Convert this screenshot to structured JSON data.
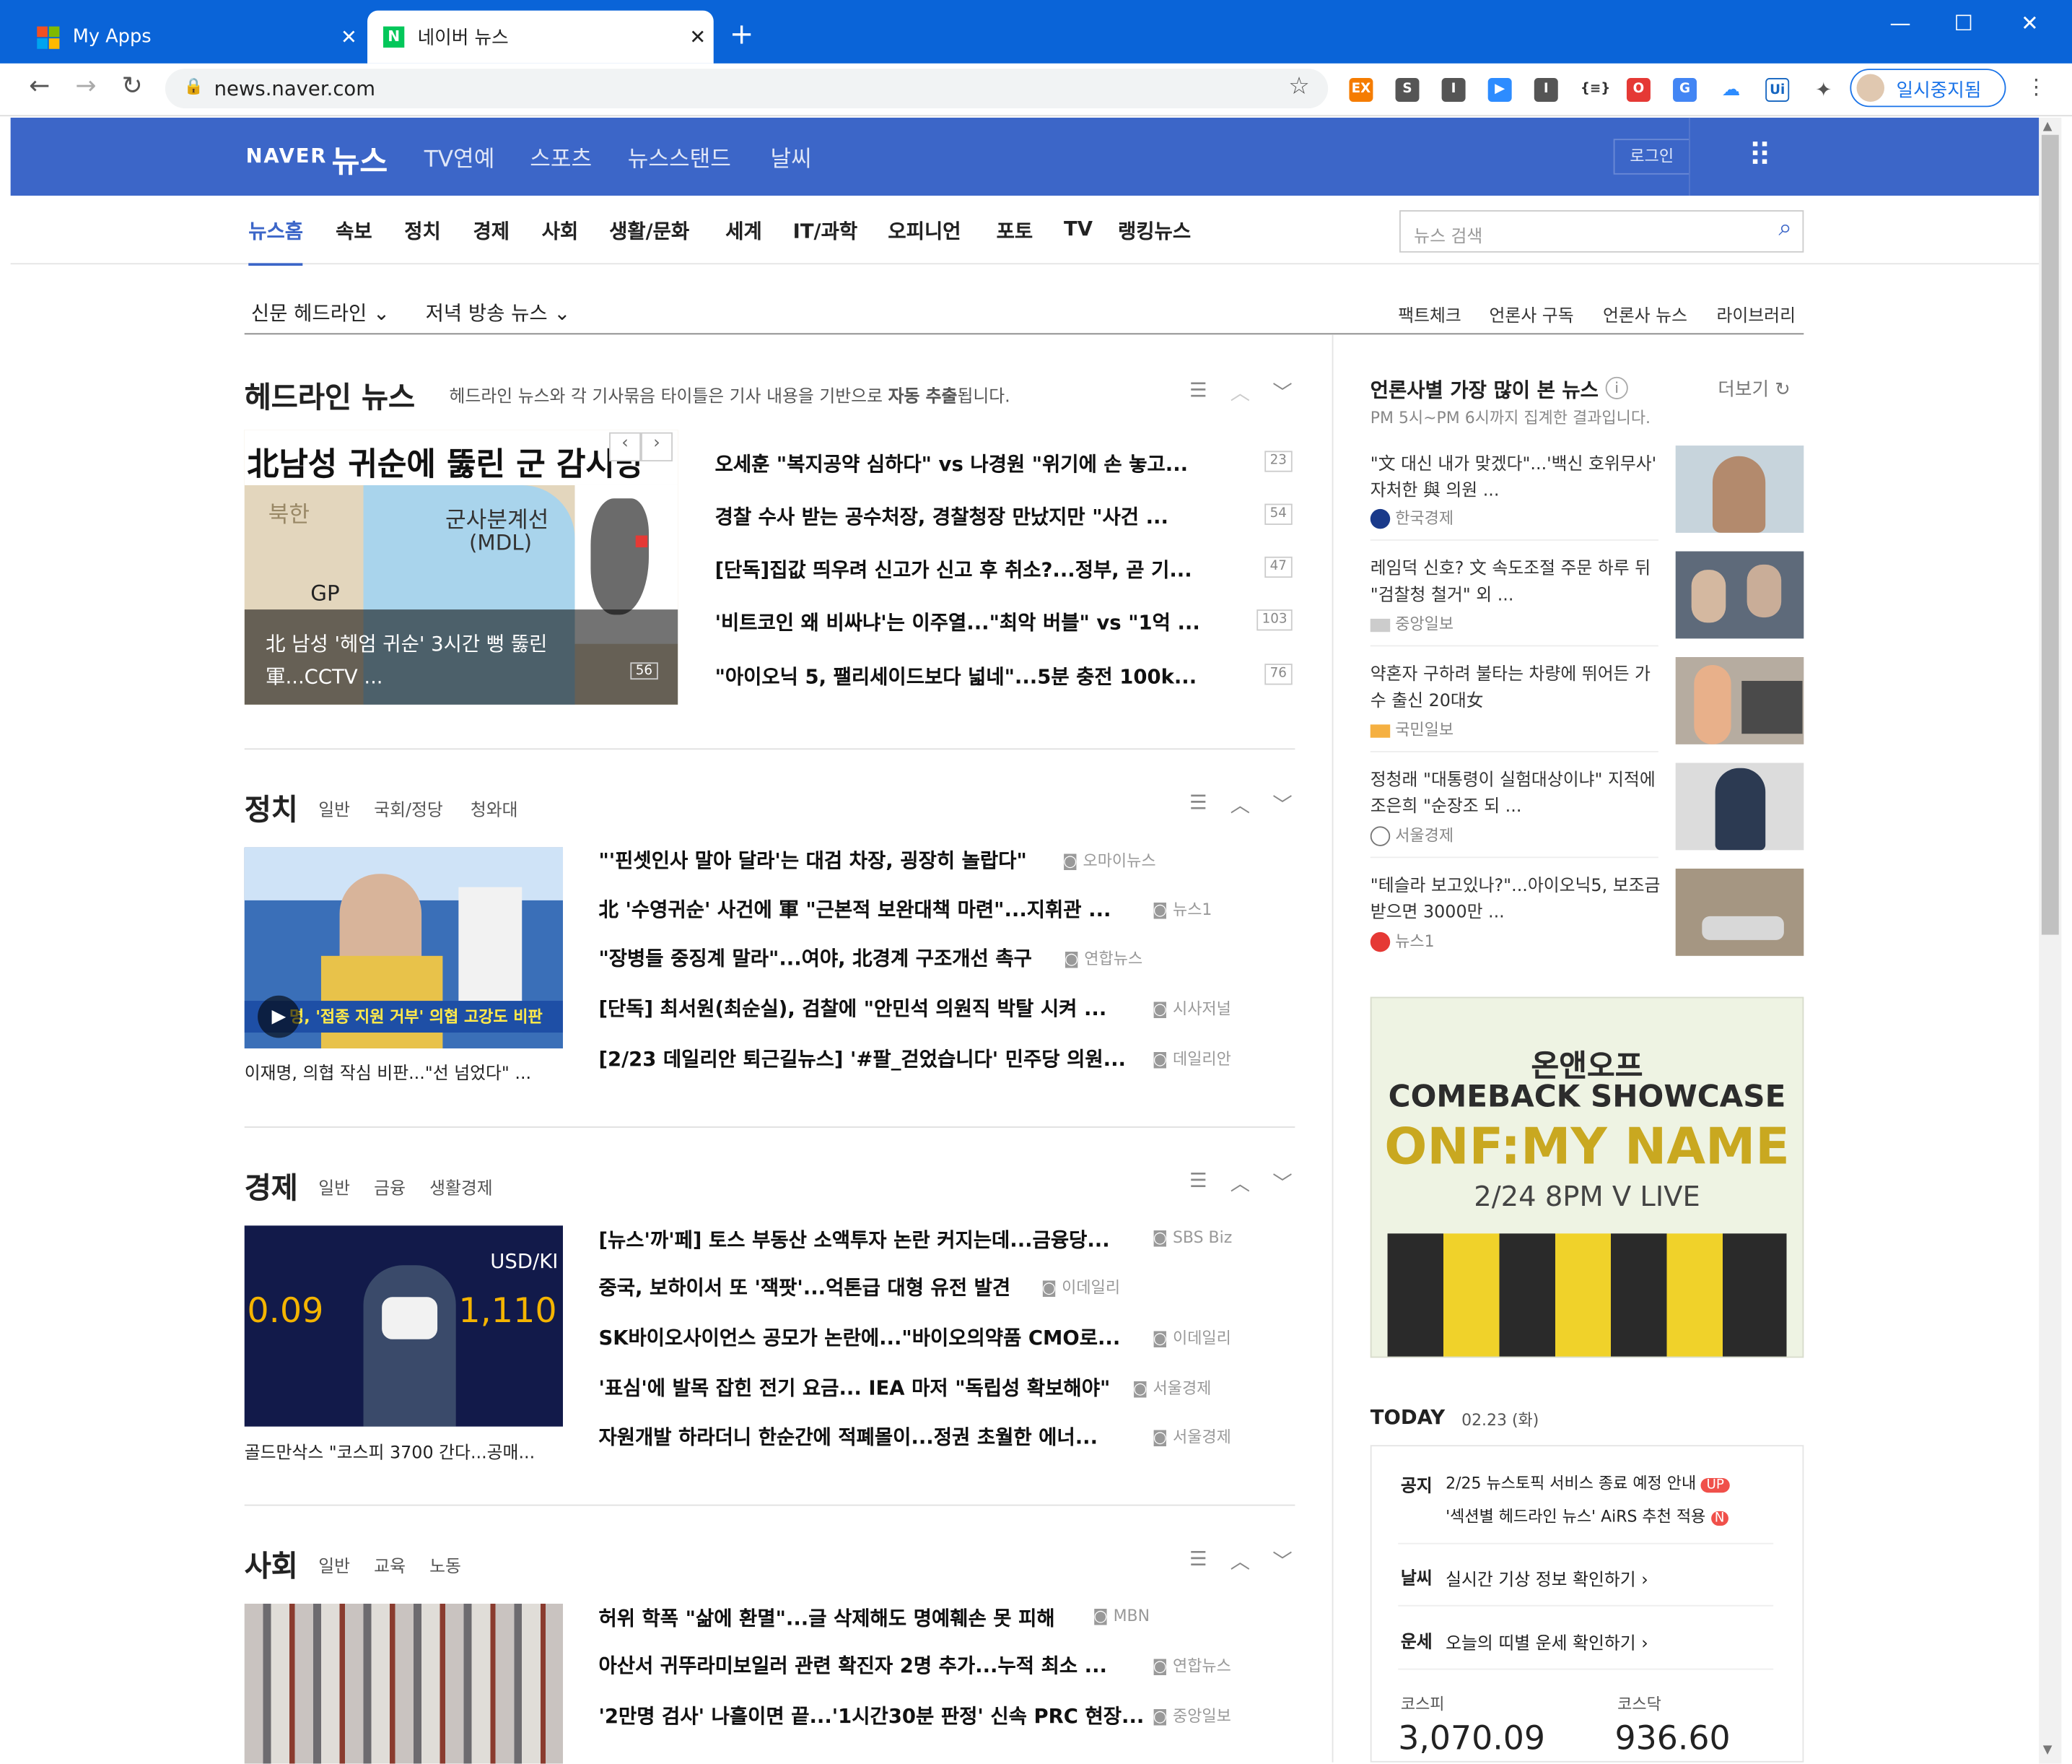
{
  "browser": {
    "tabs": [
      {
        "title": "My Apps"
      },
      {
        "title": "네이버 뉴스"
      }
    ],
    "url": "news.naver.com",
    "profile": "일시중지됨"
  },
  "naver": {
    "logo": "NAVER",
    "logo_news": "뉴스",
    "top_nav": [
      "TV연예",
      "스포츠",
      "뉴스스탠드",
      "날씨"
    ],
    "login": "로그인",
    "gnb": [
      "뉴스홈",
      "속보",
      "정치",
      "경제",
      "사회",
      "생활/문화",
      "세계",
      "IT/과학",
      "오피니언",
      "포토",
      "TV",
      "랭킹뉴스"
    ],
    "search_placeholder": "뉴스 검색",
    "sub_left": [
      "신문 헤드라인",
      "저녁 방송 뉴스"
    ],
    "sub_right": [
      "팩트체크",
      "언론사 구독",
      "언론사 뉴스",
      "라이브러리"
    ]
  },
  "headline": {
    "title": "헤드라인 뉴스",
    "desc": "헤드라인 뉴스와 각 기사묶음 타이틀은 기사 내용을 기반으로",
    "desc_bold": "자동 추출",
    "desc_end": "됩니다.",
    "photo_title": "北남성 귀순에 뚫린 군 감시망",
    "photo_caption1": "北 남성 '헤엄 귀순' 3시간 뻥 뚫린",
    "photo_caption2": "軍...CCTV ...",
    "photo_count": "56",
    "map_labels": [
      "북한",
      "군사분계선",
      "(MDL)",
      "GP"
    ],
    "items": [
      {
        "text": "오세훈 \"복지공약 심하다\" vs 나경원 \"위기에 손 놓고...",
        "count": "23"
      },
      {
        "text": "경찰 수사 받는 공수처장, 경찰청장 만났지만 \"사건 ...",
        "count": "54"
      },
      {
        "text": "[단독]집값 띄우려 신고가 신고 후 취소?...정부, 곧 기...",
        "count": "47"
      },
      {
        "text": "'비트코인 왜 비싸냐'는 이주열...\"최악 버블\" vs \"1억 ...",
        "count": "103"
      },
      {
        "text": "\"아이오닉 5, 팰리세이드보다 넓네\"...5분 충전 100k...",
        "count": "76"
      }
    ]
  },
  "sections": [
    {
      "title": "정치",
      "subs": [
        "일반",
        "국회/정당",
        "청와대"
      ],
      "caption": "이재명, 의협 작심 비판...\"선 넘었다\" ...",
      "thumb_text": "명, '접종 지원 거부' 의협 고강도 비판",
      "items": [
        {
          "text": "\"'핀셋인사 말아 달라'는 대검 차장, 굉장히 놀랍다\"",
          "src": "오마이뉴스"
        },
        {
          "text": "北 '수영귀순' 사건에 軍 \"근본적 보완대책 마련\"...지휘관 ...",
          "src": "뉴스1"
        },
        {
          "text": "\"장병들 중징계 말라\"...여야, 北경계 구조개선 촉구",
          "src": "연합뉴스"
        },
        {
          "text": "[단독] 최서원(최순실), 검찰에 \"안민석 의원직 박탈 시켜 ...",
          "src": "시사저널"
        },
        {
          "text": "[2/23 데일리안 퇴근길뉴스] '#팔_걷었습니다' 민주당 의원...",
          "src": "데일리안"
        }
      ]
    },
    {
      "title": "경제",
      "subs": [
        "일반",
        "금융",
        "생활경제"
      ],
      "caption": "골드만삭스 \"코스피 3700 간다...공매...",
      "thumb_text": "USD/KI",
      "items": [
        {
          "text": "[뉴스'까'페] 토스 부동산 소액투자 논란 커지는데...금융당...",
          "src": "SBS Biz"
        },
        {
          "text": "중국, 보하이서 또 '잭팟'...억톤급 대형 유전 발견",
          "src": "이데일리"
        },
        {
          "text": "SK바이오사이언스 공모가 논란에...\"바이오의약품 CMO로...",
          "src": "이데일리"
        },
        {
          "text": "'표심'에 발목 잡힌 전기 요금... IEA 마저 \"독립성 확보해야\"",
          "src": "서울경제"
        },
        {
          "text": "자원개발 하라더니 한순간에 적폐몰이...정권 초월한 에너...",
          "src": "서울경제"
        }
      ]
    },
    {
      "title": "사회",
      "subs": [
        "일반",
        "교육",
        "노동"
      ],
      "caption": "",
      "thumb_text": "",
      "items": [
        {
          "text": "허위 학폭 \"삶에 환멸\"...글 삭제해도 명예훼손 못 피해",
          "src": "MBN"
        },
        {
          "text": "아산서 귀뚜라미보일러 관련 확진자 2명 추가...누적 최소 ...",
          "src": "연합뉴스"
        },
        {
          "text": "'2만명 검사' 나흘이면 끝...'1시간30분 판정' 신속 PRC 현장...",
          "src": "중앙일보"
        }
      ]
    }
  ],
  "most_viewed": {
    "title": "언론사별 가장 많이 본 뉴스",
    "more": "더보기",
    "desc": "PM 5시~PM 6시까지 집계한 결과입니다.",
    "items": [
      {
        "text": "\"文 대신 내가 맞겠다\"...'백신 호위무사' 자처한 與 의원 ...",
        "src": "한국경제"
      },
      {
        "text": "레임덕 신호? 文 속도조절 주문 하루 뒤 \"검찰청 철거\" 외 ...",
        "src": "중앙일보"
      },
      {
        "text": "약혼자 구하려 불타는 차량에 뛰어든 가수 출신 20대女",
        "src": "국민일보"
      },
      {
        "text": "정청래 \"대통령이 실험대상이냐\" 지적에 조은희 \"순장조 되 ...",
        "src": "서울경제"
      },
      {
        "text": "\"테슬라 보고있나?\"...아이오닉5, 보조금 받으면 3000만 ...",
        "src": "뉴스1"
      }
    ]
  },
  "ad": {
    "line1": "온앤오프",
    "line2": "COMEBACK SHOWCASE",
    "line3": "ONF:MY NAME",
    "line4": "2/24 8PM V LIVE"
  },
  "today": {
    "label": "TODAY",
    "date": "02.23 (화)",
    "notice_label": "공지",
    "notice1": "2/25 뉴스토픽 서비스 종료 예정 안내",
    "notice2": "'섹션별 헤드라인 뉴스' AiRS 추천 적용",
    "up": "UP",
    "n": "N",
    "weather_label": "날씨",
    "weather": "실시간 기상 정보 확인하기",
    "fortune_label": "운세",
    "fortune": "오늘의 띠별 운세 확인하기",
    "kospi_label": "코스피",
    "kospi": "3,070.09",
    "kosdaq_label": "코스닥",
    "kosdaq": "936.60"
  },
  "colors": {
    "naver_blue": "#3c66c8",
    "chrome_blue": "#0a64d8",
    "naver_green": "#03c75a"
  }
}
